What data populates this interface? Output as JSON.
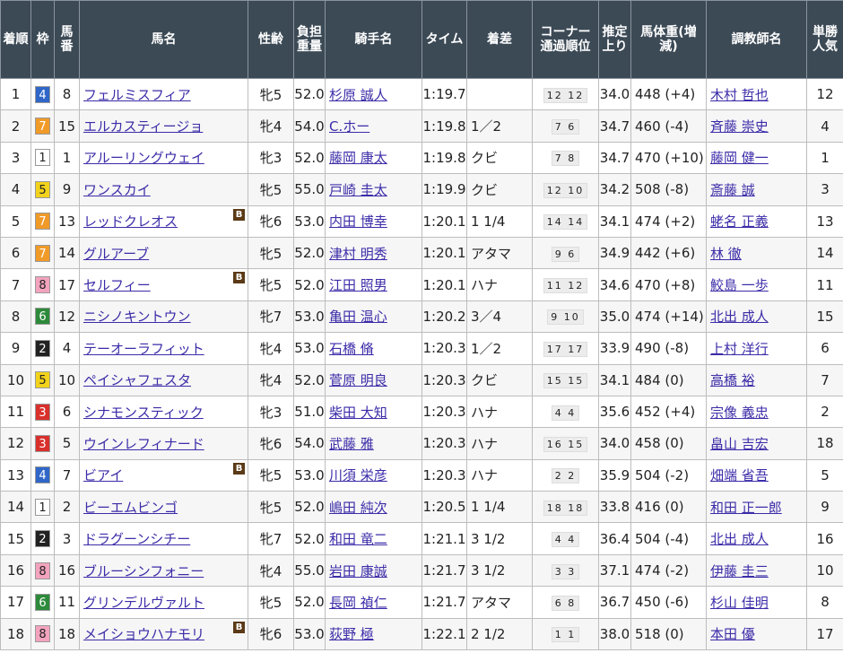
{
  "headers": {
    "rank": "着順",
    "waku": "枠",
    "umaban": "馬番",
    "horse": "馬名",
    "sexage": "性齢",
    "weight": "負担重量",
    "jockey": "騎手名",
    "time": "タイム",
    "margin": "着差",
    "corner": "コーナー通過順位",
    "agari": "推定上り",
    "bodyweight": "馬体重(増減)",
    "trainer": "調教師名",
    "popularity": "単勝人気"
  },
  "blinker_label": "B",
  "waku_colors": {
    "1": {
      "bg": "#ffffff",
      "fg": "#222222"
    },
    "2": {
      "bg": "#222222",
      "fg": "#ffffff"
    },
    "3": {
      "bg": "#d9302c",
      "fg": "#ffffff"
    },
    "4": {
      "bg": "#2f66c8",
      "fg": "#ffffff"
    },
    "5": {
      "bg": "#f2d21b",
      "fg": "#222222"
    },
    "6": {
      "bg": "#2c8a3a",
      "fg": "#ffffff"
    },
    "7": {
      "bg": "#f09a28",
      "fg": "#ffffff"
    },
    "8": {
      "bg": "#f3a3bd",
      "fg": "#222222"
    }
  },
  "rows": [
    {
      "rank": "1",
      "waku": "4",
      "umaban": "8",
      "horse": "フェルミスフィア",
      "blinker": false,
      "sexage": "牝5",
      "weight": "52.0",
      "jockey": "杉原 誠人",
      "time": "1:19.7",
      "margin": "",
      "corner": "12 12",
      "agari": "34.0",
      "bodyweight": "448 (+4)",
      "trainer": "木村 哲也",
      "popularity": "12"
    },
    {
      "rank": "2",
      "waku": "7",
      "umaban": "15",
      "horse": "エルカスティージョ",
      "blinker": false,
      "sexage": "牝4",
      "weight": "54.0",
      "jockey": "C.ホー",
      "time": "1:19.8",
      "margin": "1／2",
      "corner": "7 6",
      "agari": "34.7",
      "bodyweight": "460 (-4)",
      "trainer": "斉藤 崇史",
      "popularity": "4"
    },
    {
      "rank": "3",
      "waku": "1",
      "umaban": "1",
      "horse": "アルーリングウェイ",
      "blinker": false,
      "sexage": "牝3",
      "weight": "52.0",
      "jockey": "藤岡 康太",
      "time": "1:19.8",
      "margin": "クビ",
      "corner": "7 8",
      "agari": "34.7",
      "bodyweight": "470 (+10)",
      "trainer": "藤岡 健一",
      "popularity": "1"
    },
    {
      "rank": "4",
      "waku": "5",
      "umaban": "9",
      "horse": "ワンスカイ",
      "blinker": false,
      "sexage": "牝5",
      "weight": "55.0",
      "jockey": "戸崎 圭太",
      "time": "1:19.9",
      "margin": "クビ",
      "corner": "12 10",
      "agari": "34.2",
      "bodyweight": "508 (-8)",
      "trainer": "斎藤 誠",
      "popularity": "3"
    },
    {
      "rank": "5",
      "waku": "7",
      "umaban": "13",
      "horse": "レッドクレオス",
      "blinker": true,
      "sexage": "牝6",
      "weight": "53.0",
      "jockey": "内田 博幸",
      "time": "1:20.1",
      "margin": "1 1/4",
      "corner": "14 14",
      "agari": "34.1",
      "bodyweight": "474 (+2)",
      "trainer": "蛯名 正義",
      "popularity": "13"
    },
    {
      "rank": "6",
      "waku": "7",
      "umaban": "14",
      "horse": "グルアーブ",
      "blinker": false,
      "sexage": "牝5",
      "weight": "52.0",
      "jockey": "津村 明秀",
      "time": "1:20.1",
      "margin": "アタマ",
      "corner": "9 6",
      "agari": "34.9",
      "bodyweight": "442 (+6)",
      "trainer": "林 徹",
      "popularity": "14"
    },
    {
      "rank": "7",
      "waku": "8",
      "umaban": "17",
      "horse": "セルフィー",
      "blinker": true,
      "sexage": "牝5",
      "weight": "52.0",
      "jockey": "江田 照男",
      "time": "1:20.1",
      "margin": "ハナ",
      "corner": "11 12",
      "agari": "34.6",
      "bodyweight": "470 (+8)",
      "trainer": "鮫島 一歩",
      "popularity": "11"
    },
    {
      "rank": "8",
      "waku": "6",
      "umaban": "12",
      "horse": "ニシノキントウン",
      "blinker": false,
      "sexage": "牝7",
      "weight": "53.0",
      "jockey": "亀田 温心",
      "time": "1:20.2",
      "margin": "3／4",
      "corner": "9 10",
      "agari": "35.0",
      "bodyweight": "474 (+14)",
      "trainer": "北出 成人",
      "popularity": "15"
    },
    {
      "rank": "9",
      "waku": "2",
      "umaban": "4",
      "horse": "テーオーラフィット",
      "blinker": false,
      "sexage": "牝4",
      "weight": "53.0",
      "jockey": "石橋 脩",
      "time": "1:20.3",
      "margin": "1／2",
      "corner": "17 17",
      "agari": "33.9",
      "bodyweight": "490 (-8)",
      "trainer": "上村 洋行",
      "popularity": "6"
    },
    {
      "rank": "10",
      "waku": "5",
      "umaban": "10",
      "horse": "ペイシャフェスタ",
      "blinker": false,
      "sexage": "牝4",
      "weight": "52.0",
      "jockey": "菅原 明良",
      "time": "1:20.3",
      "margin": "クビ",
      "corner": "15 15",
      "agari": "34.1",
      "bodyweight": "484 (0)",
      "trainer": "高橋 裕",
      "popularity": "7"
    },
    {
      "rank": "11",
      "waku": "3",
      "umaban": "6",
      "horse": "シナモンスティック",
      "blinker": false,
      "sexage": "牝3",
      "weight": "51.0",
      "jockey": "柴田 大知",
      "time": "1:20.3",
      "margin": "ハナ",
      "corner": "4 4",
      "agari": "35.6",
      "bodyweight": "452 (+4)",
      "trainer": "宗像 義忠",
      "popularity": "2"
    },
    {
      "rank": "12",
      "waku": "3",
      "umaban": "5",
      "horse": "ウインレフィナード",
      "blinker": false,
      "sexage": "牝6",
      "weight": "54.0",
      "jockey": "武藤 雅",
      "time": "1:20.3",
      "margin": "ハナ",
      "corner": "16 15",
      "agari": "34.0",
      "bodyweight": "458 (0)",
      "trainer": "畠山 吉宏",
      "popularity": "18"
    },
    {
      "rank": "13",
      "waku": "4",
      "umaban": "7",
      "horse": "ビアイ",
      "blinker": true,
      "sexage": "牝5",
      "weight": "53.0",
      "jockey": "川須 栄彦",
      "time": "1:20.3",
      "margin": "ハナ",
      "corner": "2 2",
      "agari": "35.9",
      "bodyweight": "504 (-2)",
      "trainer": "畑端 省吾",
      "popularity": "5"
    },
    {
      "rank": "14",
      "waku": "1",
      "umaban": "2",
      "horse": "ビーエムビンゴ",
      "blinker": false,
      "sexage": "牝5",
      "weight": "52.0",
      "jockey": "嶋田 純次",
      "time": "1:20.5",
      "margin": "1 1/4",
      "corner": "18 18",
      "agari": "33.8",
      "bodyweight": "416 (0)",
      "trainer": "和田 正一郎",
      "popularity": "9"
    },
    {
      "rank": "15",
      "waku": "2",
      "umaban": "3",
      "horse": "ドラグーンシチー",
      "blinker": false,
      "sexage": "牝7",
      "weight": "52.0",
      "jockey": "和田 竜二",
      "time": "1:21.1",
      "margin": "3 1/2",
      "corner": "4 4",
      "agari": "36.4",
      "bodyweight": "504 (-4)",
      "trainer": "北出 成人",
      "popularity": "16"
    },
    {
      "rank": "16",
      "waku": "8",
      "umaban": "16",
      "horse": "ブルーシンフォニー",
      "blinker": false,
      "sexage": "牝4",
      "weight": "55.0",
      "jockey": "岩田 康誠",
      "time": "1:21.7",
      "margin": "3 1/2",
      "corner": "3 3",
      "agari": "37.1",
      "bodyweight": "474 (-2)",
      "trainer": "伊藤 圭三",
      "popularity": "10"
    },
    {
      "rank": "17",
      "waku": "6",
      "umaban": "11",
      "horse": "グリンデルヴァルト",
      "blinker": false,
      "sexage": "牝5",
      "weight": "52.0",
      "jockey": "長岡 禎仁",
      "time": "1:21.7",
      "margin": "アタマ",
      "corner": "6 8",
      "agari": "36.7",
      "bodyweight": "450 (-6)",
      "trainer": "杉山 佳明",
      "popularity": "8"
    },
    {
      "rank": "18",
      "waku": "8",
      "umaban": "18",
      "horse": "メイショウハナモリ",
      "blinker": true,
      "sexage": "牝6",
      "weight": "53.0",
      "jockey": "荻野 極",
      "time": "1:22.1",
      "margin": "2 1/2",
      "corner": "1 1",
      "agari": "38.0",
      "bodyweight": "518 (0)",
      "trainer": "本田 優",
      "popularity": "17"
    }
  ]
}
